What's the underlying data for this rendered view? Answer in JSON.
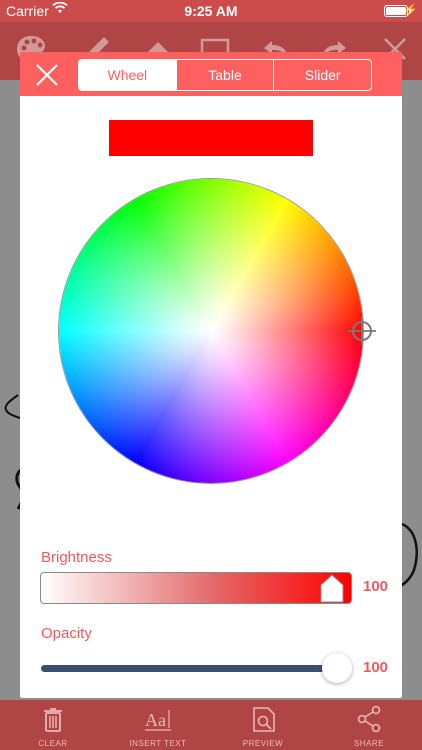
{
  "status_bar": {
    "carrier": "Carrier",
    "time": "9:25 AM"
  },
  "modal": {
    "tabs": [
      {
        "label": "Wheel",
        "active": true
      },
      {
        "label": "Table",
        "active": false
      },
      {
        "label": "Slider",
        "active": false
      }
    ],
    "selected_color": "#ff0000",
    "brightness": {
      "label": "Brightness",
      "value": "100",
      "percent": 100
    },
    "opacity": {
      "label": "Opacity",
      "value": "100",
      "percent": 100
    }
  },
  "bottom_bar": {
    "items": [
      {
        "label": "CLEAR",
        "icon": "trash-icon"
      },
      {
        "label": "INSERT TEXT",
        "icon": "text-icon"
      },
      {
        "label": "PREVIEW",
        "icon": "preview-icon"
      },
      {
        "label": "SHARE",
        "icon": "share-icon"
      }
    ]
  },
  "colors": {
    "accent": "#fe5f5f",
    "toolbar": "#b04545",
    "track": "#3a4f73"
  }
}
